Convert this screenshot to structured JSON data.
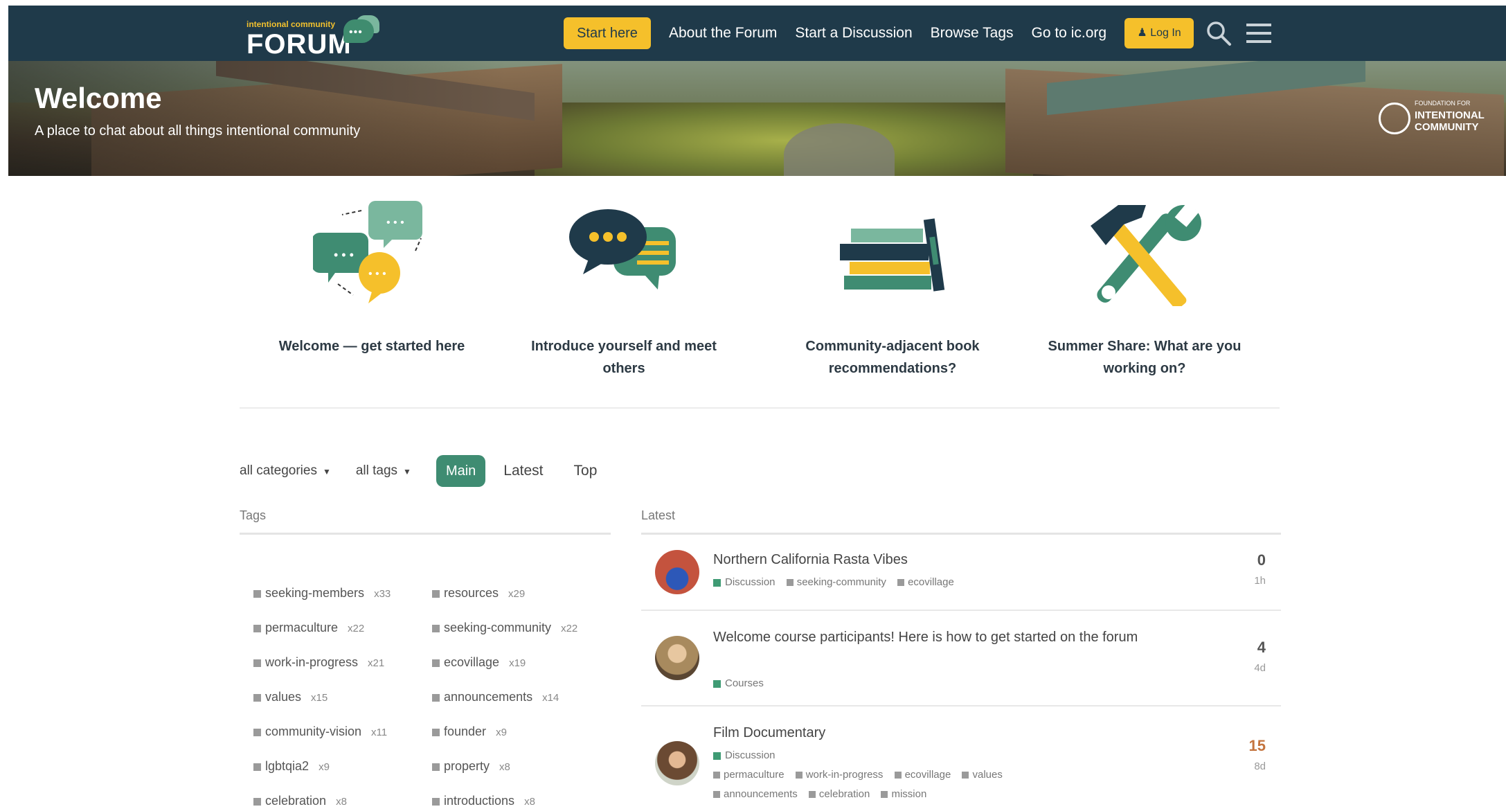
{
  "header": {
    "logo_small": "intentional community",
    "logo_word": "FORUM",
    "nav": {
      "start_here": "Start here",
      "about": "About the Forum",
      "start_discussion": "Start a Discussion",
      "browse_tags": "Browse Tags",
      "go_to_ic": "Go to ic.org",
      "login": "Log In"
    },
    "colors": {
      "bar": "#1f3a4a",
      "accent": "#f5c02b"
    }
  },
  "hero": {
    "title": "Welcome",
    "subtitle": "A place to chat about all things intentional community",
    "badge_small": "FOUNDATION FOR",
    "badge_line1": "INTENTIONAL",
    "badge_line2": "COMMUNITY"
  },
  "featured": [
    {
      "label": "Welcome — get started here",
      "icon": "chat-bubbles-icon"
    },
    {
      "label": "Introduce yourself and meet others",
      "icon": "speech-bubbles-icon"
    },
    {
      "label": "Community-adjacent book recommendations?",
      "icon": "books-icon"
    },
    {
      "label": "Summer Share: What are you working on?",
      "icon": "tools-icon"
    }
  ],
  "filters": {
    "categories": "all categories",
    "tags": "all tags",
    "main": "Main",
    "latest": "Latest",
    "top": "Top"
  },
  "tags": {
    "heading": "Tags",
    "items": [
      {
        "name": "seeking-members",
        "count": "x33"
      },
      {
        "name": "resources",
        "count": "x29"
      },
      {
        "name": "permaculture",
        "count": "x22"
      },
      {
        "name": "seeking-community",
        "count": "x22"
      },
      {
        "name": "work-in-progress",
        "count": "x21"
      },
      {
        "name": "ecovillage",
        "count": "x19"
      },
      {
        "name": "values",
        "count": "x15"
      },
      {
        "name": "announcements",
        "count": "x14"
      },
      {
        "name": "community-vision",
        "count": "x11"
      },
      {
        "name": "founder",
        "count": "x9"
      },
      {
        "name": "lgbtqia2",
        "count": "x9"
      },
      {
        "name": "property",
        "count": "x8"
      },
      {
        "name": "celebration",
        "count": "x8"
      },
      {
        "name": "introductions",
        "count": "x8"
      }
    ]
  },
  "latest": {
    "heading": "Latest",
    "topics": [
      {
        "title": "Northern California Rasta Vibes",
        "category": "Discussion",
        "tags": [
          "seeking-community",
          "ecovillage"
        ],
        "tags2": [],
        "count": "0",
        "age": "1h"
      },
      {
        "title": "Welcome course participants! Here is how to get started on the forum",
        "category": "Courses",
        "tags": [],
        "tags2": [],
        "count": "4",
        "age": "4d"
      },
      {
        "title": "Film Documentary",
        "category": "Discussion",
        "tags": [
          "permaculture",
          "work-in-progress",
          "ecovillage",
          "values"
        ],
        "tags2": [
          "announcements",
          "celebration",
          "mission"
        ],
        "count": "15",
        "age": "8d"
      }
    ]
  }
}
